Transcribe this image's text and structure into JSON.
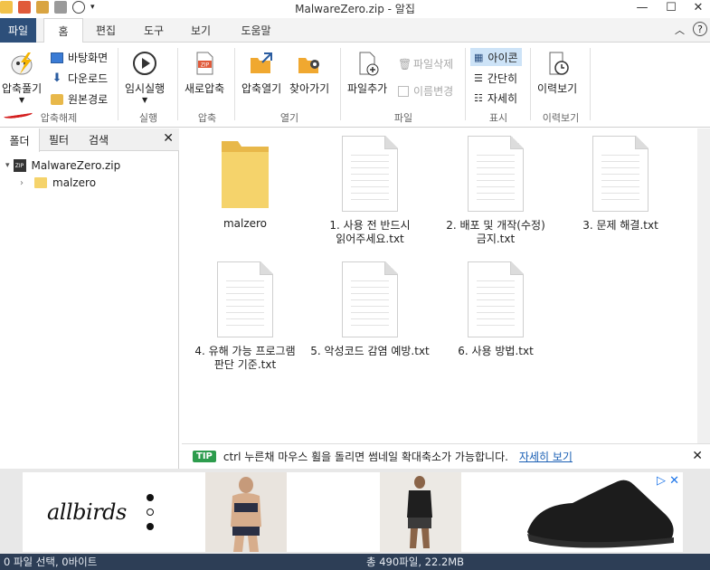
{
  "window": {
    "title": "MalwareZero.zip - 알집",
    "minimize": "—",
    "maximize": "☐",
    "close": "✕"
  },
  "ribbon_tabs": [
    "파일",
    "홈",
    "편집",
    "도구",
    "보기",
    "도움말"
  ],
  "ribbon": {
    "extract_label": "압축풀기",
    "desktop_label": "바탕화면",
    "downloads_label": "다운로드",
    "original_path_label": "원본경로",
    "group_extract": "압축해제",
    "run_label": "임시실행",
    "group_run": "실행",
    "new_zip_label": "새로압축",
    "group_compress": "압축",
    "open_archive_label": "압축열기",
    "find_label": "찾아가기",
    "group_open": "열기",
    "add_file_label": "파일추가",
    "delete_file_label": "파일삭제",
    "rename_label": "이름변경",
    "group_file": "파일",
    "view_icon_label": "아이콘",
    "view_simple_label": "간단히",
    "view_detail_label": "자세히",
    "group_view": "표시",
    "history_label": "이력보기",
    "group_history": "이력보기"
  },
  "left_pane": {
    "tabs": [
      "폴더",
      "필터",
      "검색"
    ],
    "root": "MalwareZero.zip",
    "child": "malzero"
  },
  "files": [
    {
      "name": "malzero",
      "type": "folder"
    },
    {
      "name": "1. 사용 전 반드시\n읽어주세요.txt",
      "type": "txt"
    },
    {
      "name": "2. 배포 및 개작(수정)\n금지.txt",
      "type": "txt"
    },
    {
      "name": "3. 문제 해결.txt",
      "type": "txt"
    },
    {
      "name": "4. 유해 가능 프로그램\n판단 기준.txt",
      "type": "txt"
    },
    {
      "name": "5. 악성코드 감염 예방.txt",
      "type": "txt"
    },
    {
      "name": "6. 사용 방법.txt",
      "type": "txt"
    }
  ],
  "tip": {
    "badge": "TIP",
    "text": "ctrl 누른채 마우스 휠을 돌리면 썸네일 확대축소가 가능합니다.",
    "link": "자세히 보기"
  },
  "ad": {
    "brand": "allbirds"
  },
  "status": {
    "selection": "0 파일 선택,  0바이트",
    "total": "총 490파일,  22.2MB"
  },
  "colors": {
    "accent": "#2d4f7a",
    "statusbar": "#2d3e56",
    "selection": "#cde3f7",
    "tip_badge": "#2d9c4d",
    "folder": "#f5d36b"
  }
}
